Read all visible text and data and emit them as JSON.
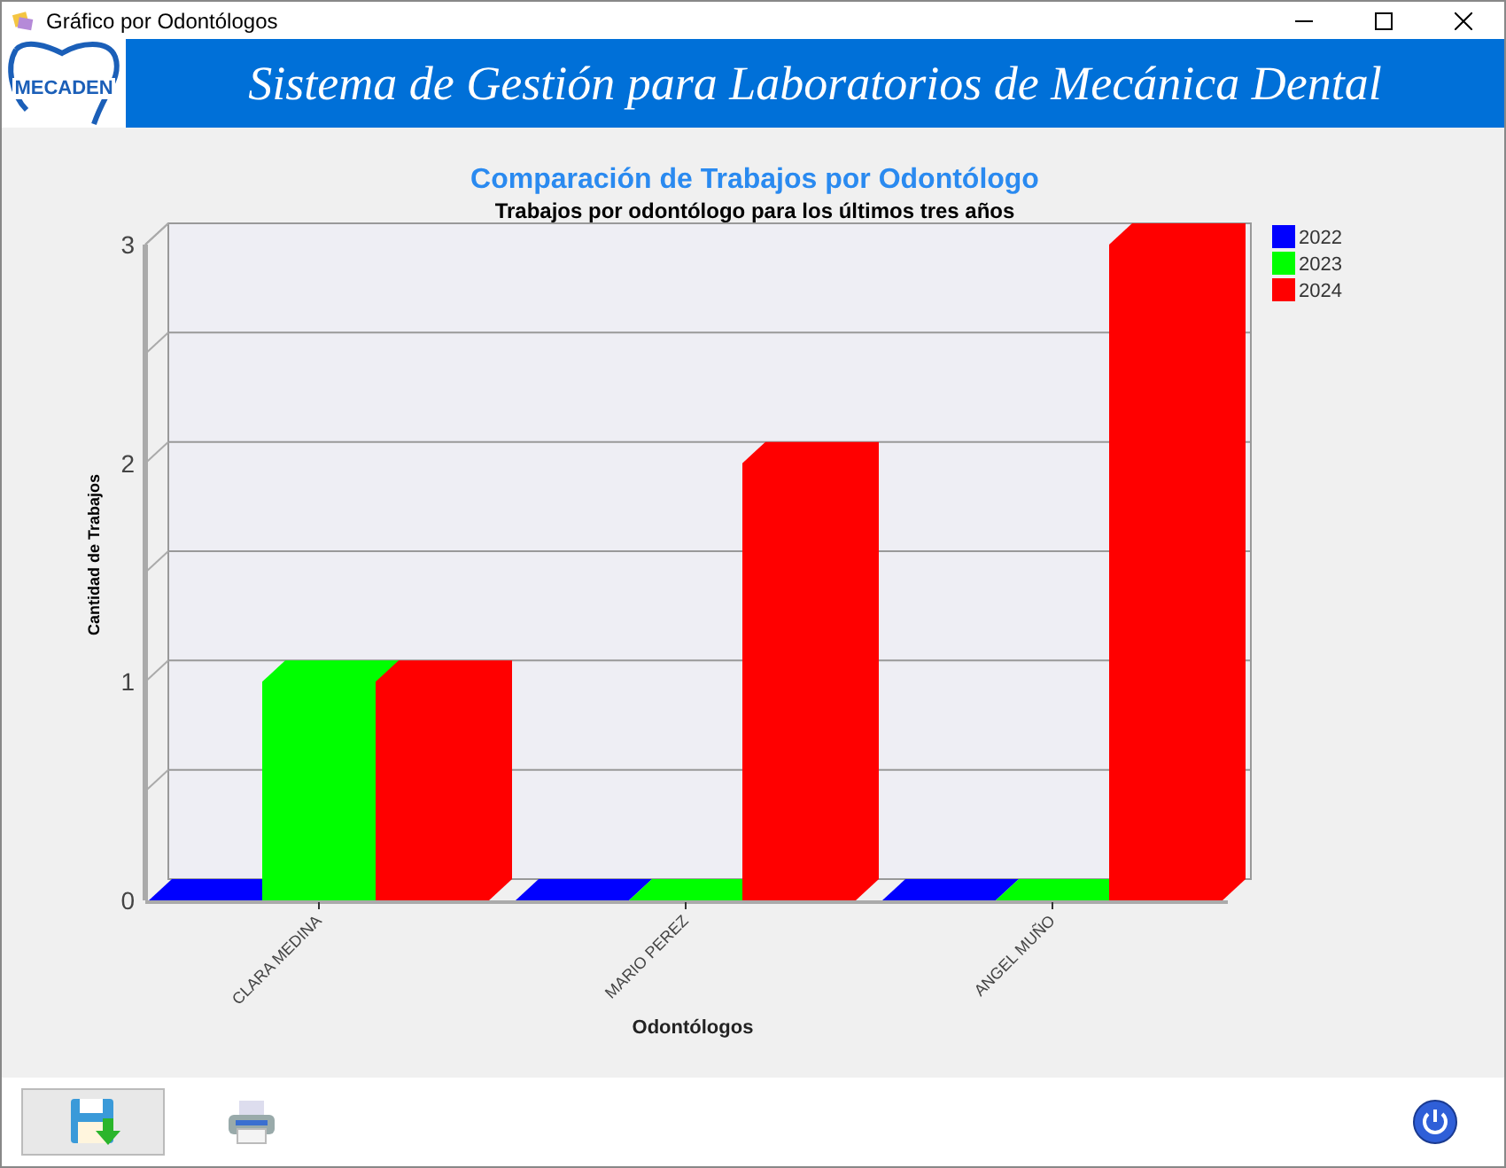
{
  "window": {
    "title": "Gráfico por Odontólogos"
  },
  "header": {
    "logo_text": "MECADEN",
    "title": "Sistema de Gestión para Laboratorios de Mecánica Dental"
  },
  "chart": {
    "chart_data": {
      "type": "bar",
      "title": "Comparación de Trabajos por Odontólogo",
      "subtitle": "Trabajos por odontólogo para los últimos tres años",
      "xlabel": "Odontólogos",
      "ylabel": "Cantidad de Trabajos",
      "legend": "right",
      "categories": [
        "CLARA MEDINA",
        "MARIO PEREZ",
        "ANGEL MUÑO"
      ],
      "ylim": [
        0,
        3
      ],
      "yticks": [
        0,
        1,
        2,
        3
      ],
      "series": [
        {
          "name": "2022",
          "color": "#0000ff",
          "values": [
            0,
            0,
            0
          ]
        },
        {
          "name": "2023",
          "color": "#00ff00",
          "values": [
            1,
            0,
            0
          ]
        },
        {
          "name": "2024",
          "color": "#ff0000",
          "values": [
            1,
            2,
            3
          ]
        }
      ]
    }
  }
}
